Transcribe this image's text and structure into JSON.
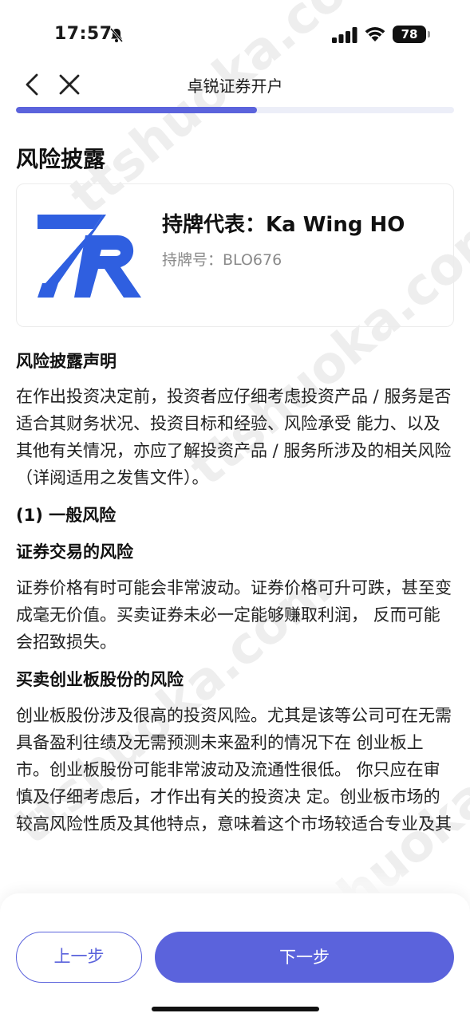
{
  "status_bar": {
    "time": "17:57",
    "battery": "78"
  },
  "nav": {
    "title": "卓锐证券开户"
  },
  "progress": {
    "fraction": 0.55
  },
  "page_title": "风险披露",
  "representative": {
    "name": "持牌代表：Ka Wing HO",
    "license": "持牌号：BLO676",
    "logo_color": "#2f5fe0"
  },
  "sections": {
    "disclosure_heading": "风险披露声明",
    "disclosure_text": "在作出投资决定前，投资者应仔细考虑投资产品 / 服务是否适合其财务状况、投资目标和经验、风险承受 能力、以及其他有关情况，亦应了解投资产品 / 服务所涉及的相关风险（详阅适用之发售文件）。",
    "general_heading": "(1) 一般风险",
    "securities_heading": "证券交易的风险",
    "securities_text": "证券价格有时可能会非常波动。证券价格可升可跌，甚至变成毫无价值。买卖证券未必一定能够赚取利润， 反而可能会招致损失。",
    "gem_heading": "买卖创业板股份的风险",
    "gem_text": "创业板股份涉及很高的投资风险。尤其是该等公司可在无需具备盈利往绩及无需预测未来盈利的情况下在 创业板上市。创业板股份可能非常波动及流通性很低。 你只应在审慎及仔细考虑后，才作出有关的投资决 定。创业板市场的较高风险性质及其他特点，意味着这个市场较适合专业及其"
  },
  "buttons": {
    "prev": "上一步",
    "next": "下一步"
  },
  "colors": {
    "accent": "#5b63dc",
    "track": "#eceef8"
  },
  "icons": [
    "bell-muted-icon",
    "signal-icon",
    "wifi-icon",
    "battery-icon",
    "back-icon",
    "close-icon",
    "zr-logo"
  ]
}
